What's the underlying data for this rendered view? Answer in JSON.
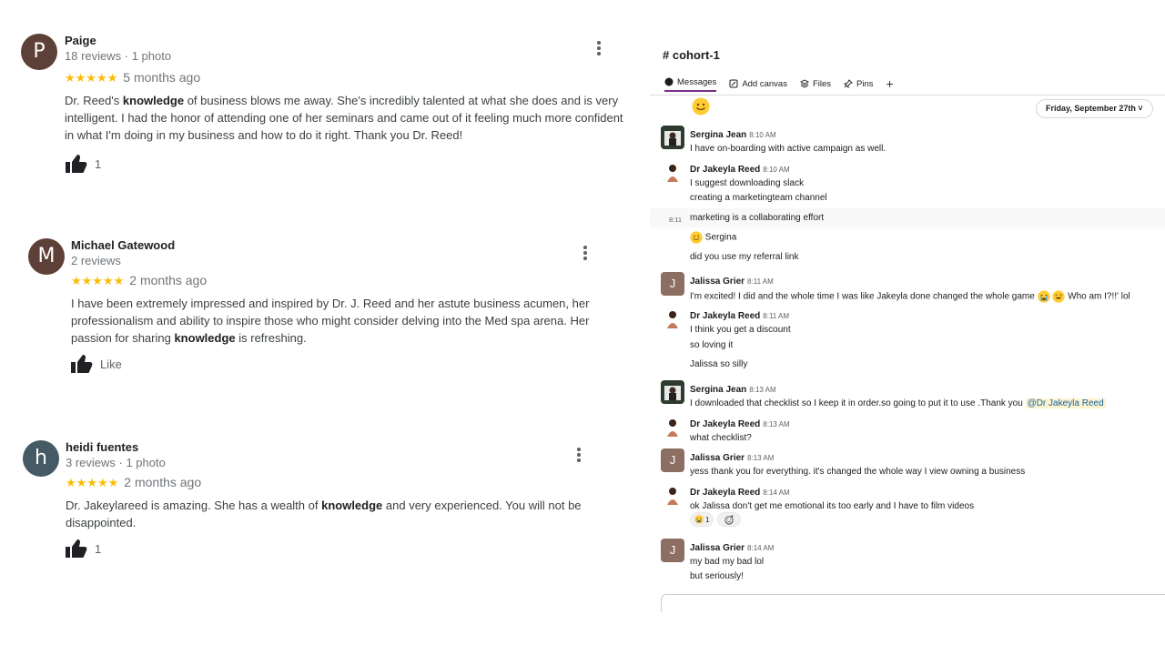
{
  "reviews": [
    {
      "initial": "P",
      "avatar_color": "#5d4037",
      "name": "Paige",
      "meta": "18 reviews · 1 photo",
      "stars": "★★★★★",
      "date": "5 months ago",
      "text_parts": [
        "Dr. Reed's ",
        "knowledge",
        " of business blows me away. She's incredibly talented at what she does and is very intelligent. I had the honor of attending one of her seminars and came out of it feeling much more confident in what I'm doing in my business and how to do it right. Thank you Dr. Reed!"
      ],
      "like_label": "1"
    },
    {
      "initial": "M",
      "avatar_color": "#5d4037",
      "name": "Michael Gatewood",
      "meta": "2 reviews",
      "stars": "★★★★★",
      "date": "2 months ago",
      "text_parts": [
        "I have been extremely impressed and inspired by Dr. J. Reed and her astute business acumen,  her professionalism and ability to inspire those who might consider delving into the Med spa arena. Her passion for sharing ",
        "knowledge",
        " is refreshing."
      ],
      "like_label": "Like"
    },
    {
      "initial": "h",
      "avatar_color": "#455a64",
      "name": "heidi fuentes",
      "meta": "3 reviews · 1 photo",
      "stars": "★★★★★",
      "date": "2 months ago",
      "text_parts": [
        "Dr. Jakeylareed is amazing. She has a wealth of ",
        "knowledge",
        " and very experienced. You will not be disappointed."
      ],
      "like_label": "1"
    }
  ],
  "slack": {
    "channel": "# cohort-1",
    "tabs": [
      "Messages",
      "Add canvas",
      "Files",
      "Pins"
    ],
    "add_tab": "+",
    "date_pill": "Friday, September 27th",
    "hover_time": "8:11",
    "messages": [
      {
        "name": "Sergina Jean",
        "time": "8:10 AM",
        "text": "I have on-boarding with active campaign as well."
      },
      {
        "name": "Dr Jakeyla Reed",
        "time": "8:10 AM",
        "text": "I suggest downloading slack"
      },
      {
        "name": "Jalissa Grier",
        "time": "8:11 AM",
        "text": "I'm excited! I did and the whole time I was like Jakeyla done changed the whole game",
        "text_after": "Who am I?!!' lol"
      },
      {
        "name": "Dr Jakeyla Reed",
        "time": "8:11 AM",
        "text": "I think you get a discount"
      },
      {
        "name": "Sergina Jean",
        "time": "8:13 AM",
        "text": "I downloaded that checklist so I keep it in order.so going to put it to use .Thank you ",
        "mention": "@Dr Jakeyla Reed"
      },
      {
        "name": "Dr Jakeyla Reed",
        "time": "8:13 AM",
        "text": "what checklist?"
      },
      {
        "name": "Jalissa Grier",
        "time": "8:13 AM",
        "text": "yess thank you for everything. it's changed the whole way I view owning a business"
      },
      {
        "name": "Dr Jakeyla Reed",
        "time": "8:14 AM",
        "text": "ok Jalissa don't get me emotional its too early and I have to film videos"
      },
      {
        "name": "Jalissa Grier",
        "time": "8:14 AM",
        "text": "my bad my bad lol"
      }
    ],
    "continuations": [
      "creating a marketingteam channel",
      "marketing is a collaborating effort",
      "Sergina",
      "did you use my referral link",
      "so loving it",
      "Jalissa so silly",
      "but seriously!"
    ],
    "reaction_count": "1",
    "jalissa_initial": "J",
    "colors": {
      "accent": "#7a2e8a",
      "mention_bg": "#fdf3cf",
      "mention_fg": "#1264a3",
      "jalissa_avatar": "#8d6e63"
    }
  }
}
